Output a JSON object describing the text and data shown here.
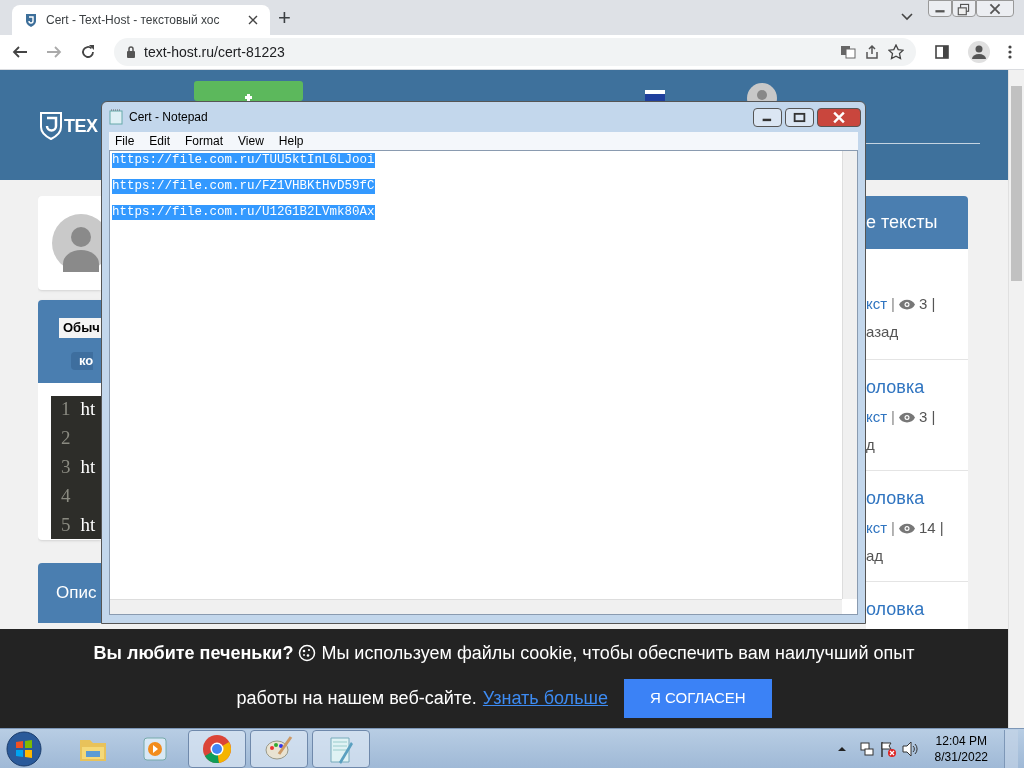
{
  "browser": {
    "tabs": [
      {
        "title": "Cert - Text-Host - текстовый хос",
        "selected": true
      }
    ],
    "new_tab": "+",
    "url": "text-host.ru/cert-81223"
  },
  "page": {
    "logo": "TEX",
    "editor_card": {
      "select_label": "Обыч",
      "button": "ко",
      "code_lines": [
        {
          "number": "1",
          "text": "ht"
        },
        {
          "number": "2"
        },
        {
          "number": "3",
          "text": "ht"
        },
        {
          "number": "4"
        },
        {
          "number": "5",
          "text": "ht"
        }
      ]
    },
    "description_heading": "Опис",
    "sidebar": {
      "heading": "е тексты",
      "items": [
        {
          "meta_link": "кст",
          "meta_sep": "|",
          "views": "3 |",
          "time": "азад"
        },
        {
          "title": "оловка",
          "meta_link": "кст",
          "meta_sep": "|",
          "views": "3 |",
          "time": "д"
        },
        {
          "title": "оловка",
          "meta_link": "кст",
          "meta_sep": "|",
          "views": "14 |",
          "time": "ад"
        },
        {
          "title": "оловка"
        }
      ]
    }
  },
  "notepad": {
    "title": "Cert - Notepad",
    "menu": [
      "File",
      "Edit",
      "Format",
      "View",
      "Help"
    ],
    "lines": [
      {
        "text": "https://file.com.ru/TUU5ktInL6LJooi",
        "selected": true
      },
      {
        "text": "https://file.com.ru/FZ1VHBKtHvD59fC",
        "selected": true
      },
      {
        "text": "https://file.com.ru/U12G1B2LVmk80Ax",
        "selected": true
      }
    ]
  },
  "cookie_bar": {
    "lead": "Вы любите печеньки?",
    "line1": "Мы используем файлы cookie, чтобы обеспечить вам наилучший опыт",
    "line2": "работы на нашем веб-сайте.",
    "link": "Узнать больше",
    "button": "Я СОГЛАСЕН"
  },
  "taskbar": {
    "apps": [
      {
        "kind": "folder",
        "running": false
      },
      {
        "kind": "media",
        "running": false
      },
      {
        "kind": "chrome",
        "running": true
      },
      {
        "kind": "paint",
        "running": true
      },
      {
        "kind": "notepad",
        "running": true
      }
    ],
    "time": "12:04 PM",
    "date": "8/31/2022"
  }
}
